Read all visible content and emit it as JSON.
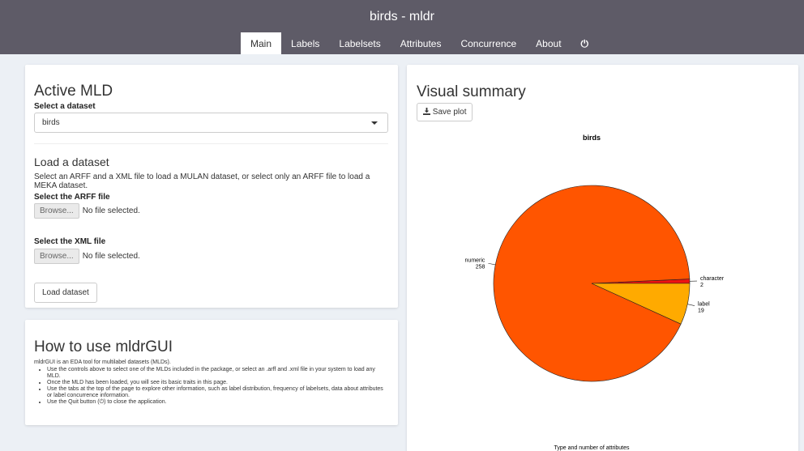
{
  "app": {
    "title": "birds - mldr"
  },
  "nav": {
    "tabs": [
      "Main",
      "Labels",
      "Labelsets",
      "Attributes",
      "Concurrence",
      "About"
    ],
    "power_icon": "⏻"
  },
  "active_mld": {
    "title": "Active MLD",
    "select_label": "Select a dataset",
    "selected_value": "birds"
  },
  "load_dataset": {
    "title": "Load a dataset",
    "description": "Select an ARFF and a XML file to load a MULAN dataset, or select only an ARFF file to load a MEKA dataset.",
    "arff_label": "Select the ARFF file",
    "xml_label": "Select the XML file",
    "browse_label": "Browse...",
    "no_file_text": "No file selected.",
    "load_button": "Load dataset"
  },
  "howto": {
    "title": "How to use mldrGUI",
    "intro": "mldrGUI is an EDA tool for multilabel datasets (MLDs).",
    "items": [
      "Use the controls above to select one of the MLDs included in the package, or select an .arff and .xml file in your system to load any MLD.",
      "Once the MLD has been loaded, you will see its basic traits in this page.",
      "Use the tabs at the top of the page to explore other information, such as label distribution, frequency of labelsets, data about attributes or label concurrence information.",
      "Use the Quit button (⏻) to close the application."
    ]
  },
  "visual_summary": {
    "title": "Visual summary",
    "save_button": "Save plot",
    "download_icon": "download-icon"
  },
  "chart_data": {
    "type": "pie",
    "title": "birds",
    "xlabel": "Type and number of attributes",
    "slices": [
      {
        "label": "numeric",
        "value": 258,
        "color": "#ff5500"
      },
      {
        "label": "character",
        "value": 2,
        "color": "#ee1111"
      },
      {
        "label": "label",
        "value": 19,
        "color": "#ffaa00"
      }
    ]
  }
}
